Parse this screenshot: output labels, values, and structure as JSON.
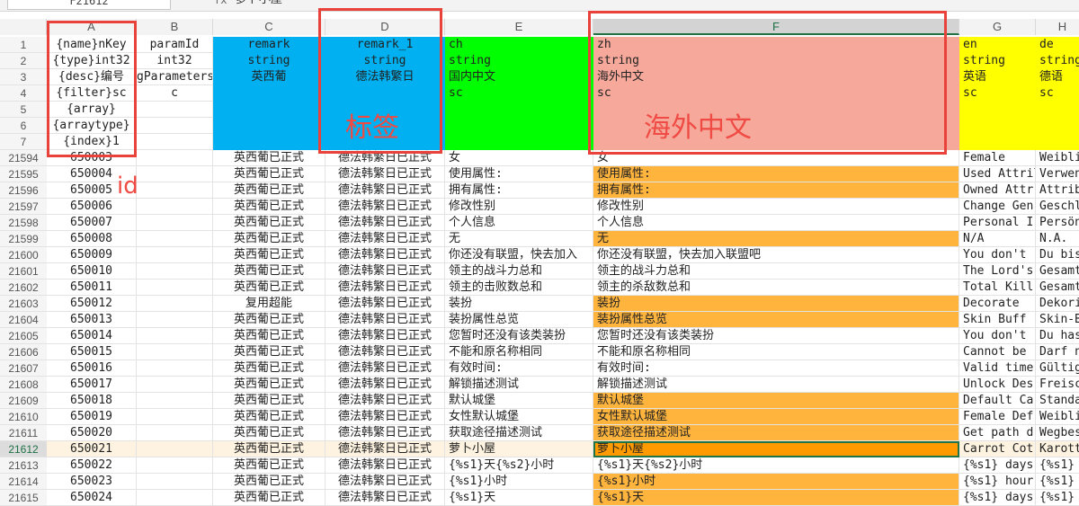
{
  "toolbar": {
    "name_box": "F21612",
    "fx": "fx",
    "formula_value": "萝卜小屋"
  },
  "column_headers": [
    "A",
    "B",
    "C",
    "D",
    "E",
    "F",
    "G",
    "H"
  ],
  "header_rows": {
    "row_numbers": [
      "1",
      "2",
      "3",
      "4",
      "5",
      "6",
      "7"
    ],
    "A": [
      "{name}nKey",
      "{type}int32",
      "{desc}编号",
      "{filter}sc",
      "{array}",
      "{arraytype}",
      "{index}1"
    ],
    "B": [
      "paramId",
      "int32",
      "gParameters",
      "c",
      "",
      "",
      ""
    ],
    "C": [
      "remark",
      "string",
      "英西葡",
      "",
      "",
      "",
      ""
    ],
    "D": [
      "remark_1",
      "string",
      "德法韩繁日",
      "",
      "",
      "",
      ""
    ],
    "E": [
      "ch",
      "string",
      "国内中文",
      "sc",
      "",
      "",
      ""
    ],
    "F": [
      "zh",
      "string",
      "海外中文",
      "sc",
      "",
      "",
      ""
    ],
    "G": [
      "en",
      "string",
      "英语",
      "sc",
      "",
      "",
      ""
    ],
    "H": [
      "de",
      "string",
      "德语",
      "sc",
      "",
      "",
      ""
    ]
  },
  "rows": [
    {
      "n": "21594",
      "a": "650003",
      "b": "",
      "c": "英西葡已正式",
      "d": "德法韩繁日已正式",
      "e": "女",
      "f": "女",
      "g": "Female",
      "h": "Weibli",
      "f_hl": false
    },
    {
      "n": "21595",
      "a": "650004",
      "b": "",
      "c": "英西葡已正式",
      "d": "德法韩繁日已正式",
      "e": "使用属性:",
      "f": "使用属性:",
      "g": "Used Attril",
      "h": "Verwen",
      "f_hl": true
    },
    {
      "n": "21596",
      "a": "650005",
      "b": "",
      "c": "英西葡已正式",
      "d": "德法韩繁日已正式",
      "e": "拥有属性:",
      "f": "拥有属性:",
      "g": "Owned Attr",
      "h": "Attrib",
      "f_hl": true
    },
    {
      "n": "21597",
      "a": "650006",
      "b": "",
      "c": "英西葡已正式",
      "d": "德法韩繁日已正式",
      "e": "修改性别",
      "f": "修改性别",
      "g": "Change Gen",
      "h": "Geschl",
      "f_hl": false
    },
    {
      "n": "21598",
      "a": "650007",
      "b": "",
      "c": "英西葡已正式",
      "d": "德法韩繁日已正式",
      "e": "个人信息",
      "f": "个人信息",
      "g": "Personal I",
      "h": "Persön",
      "f_hl": false
    },
    {
      "n": "21599",
      "a": "650008",
      "b": "",
      "c": "英西葡已正式",
      "d": "德法韩繁日已正式",
      "e": "无",
      "f": "无",
      "g": "N/A",
      "h": "N.A.",
      "f_hl": true
    },
    {
      "n": "21600",
      "a": "650009",
      "b": "",
      "c": "英西葡已正式",
      "d": "德法韩繁日已正式",
      "e": "你还没有联盟，快去加入",
      "f": "你还没有联盟，快去加入联盟吧",
      "g": "You don't",
      "h": "Du bis",
      "f_hl": false
    },
    {
      "n": "21601",
      "a": "650010",
      "b": "",
      "c": "英西葡已正式",
      "d": "德法韩繁日已正式",
      "e": "领主的战斗力总和",
      "f": "领主的战斗力总和",
      "g": "The Lord's",
      "h": "Gesamt",
      "f_hl": false
    },
    {
      "n": "21602",
      "a": "650011",
      "b": "",
      "c": "英西葡已正式",
      "d": "德法韩繁日已正式",
      "e": "领主的击败数总和",
      "f": "领主的杀敌数总和",
      "g": "Total Kill",
      "h": "Gesamt",
      "f_hl": false
    },
    {
      "n": "21603",
      "a": "650012",
      "b": "",
      "c": "复用超能",
      "d": "德法韩繁日已正式",
      "e": "装扮",
      "f": "装扮",
      "g": "Decorate",
      "h": "Dekori",
      "f_hl": true
    },
    {
      "n": "21604",
      "a": "650013",
      "b": "",
      "c": "英西葡已正式",
      "d": "德法韩繁日已正式",
      "e": "装扮属性总览",
      "f": "装扮属性总览",
      "g": "Skin Buff",
      "h": "Skin-B",
      "f_hl": true
    },
    {
      "n": "21605",
      "a": "650014",
      "b": "",
      "c": "英西葡已正式",
      "d": "德法韩繁日已正式",
      "e": "您暂时还没有该类装扮",
      "f": "您暂时还没有该类装扮",
      "g": "You don't",
      "h": "Du has",
      "f_hl": false
    },
    {
      "n": "21606",
      "a": "650015",
      "b": "",
      "c": "英西葡已正式",
      "d": "德法韩繁日已正式",
      "e": "不能和原名称相同",
      "f": "不能和原名称相同",
      "g": "Cannot be",
      "h": "Darf n",
      "f_hl": false
    },
    {
      "n": "21607",
      "a": "650016",
      "b": "",
      "c": "英西葡已正式",
      "d": "德法韩繁日已正式",
      "e": "有效时间:",
      "f": "有效时间:",
      "g": "Valid time",
      "h": "Gültig",
      "f_hl": false
    },
    {
      "n": "21608",
      "a": "650017",
      "b": "",
      "c": "英西葡已正式",
      "d": "德法韩繁日已正式",
      "e": "解锁描述测试",
      "f": "解锁描述测试",
      "g": "Unlock Des",
      "h": "Freisc",
      "f_hl": false
    },
    {
      "n": "21609",
      "a": "650018",
      "b": "",
      "c": "英西葡已正式",
      "d": "德法韩繁日已正式",
      "e": "默认城堡",
      "f": "默认城堡",
      "g": "Default Ca",
      "h": "Standa",
      "f_hl": true
    },
    {
      "n": "21610",
      "a": "650019",
      "b": "",
      "c": "英西葡已正式",
      "d": "德法韩繁日已正式",
      "e": "女性默认城堡",
      "f": "女性默认城堡",
      "g": "Female Def",
      "h": "Weibli",
      "f_hl": true
    },
    {
      "n": "21611",
      "a": "650020",
      "b": "",
      "c": "英西葡已正式",
      "d": "德法韩繁日已正式",
      "e": "获取途径描述测试",
      "f": "获取途径描述测试",
      "g": "Get path d",
      "h": "Wegbes",
      "f_hl": true
    },
    {
      "n": "21612",
      "a": "650021",
      "b": "",
      "c": "英西葡已正式",
      "d": "德法韩繁日已正式",
      "e": "萝卜小屋",
      "f": "萝卜小屋",
      "g": "Carrot Cot",
      "h": "Karott",
      "f_hl": true,
      "selected": true
    },
    {
      "n": "21613",
      "a": "650022",
      "b": "",
      "c": "英西葡已正式",
      "d": "德法韩繁日已正式",
      "e": "{%s1}天{%s2}小时",
      "f": "{%s1}天{%s2}小时",
      "g": "{%s1} days",
      "h": "{%s1}",
      "f_hl": false
    },
    {
      "n": "21614",
      "a": "650023",
      "b": "",
      "c": "英西葡已正式",
      "d": "德法韩繁日已正式",
      "e": "{%s1}小时",
      "f": "{%s1}小时",
      "g": "{%s1} hour",
      "h": "{%s1}",
      "f_hl": true
    },
    {
      "n": "21615",
      "a": "650024",
      "b": "",
      "c": "英西葡已正式",
      "d": "德法韩繁日已正式",
      "e": "{%s1}天",
      "f": "{%s1}天",
      "g": "{%s1} days",
      "h": "{%s1}",
      "f_hl": true
    }
  ],
  "annotations": {
    "id_label": "id",
    "tag_label": "标签",
    "overseas_label": "海外中文"
  },
  "colors": {
    "blue": "#00b0f0",
    "green": "#00ff00",
    "salmon": "#f6a89a",
    "yellow": "#ffff00",
    "orange": "#ffb43d",
    "selected_orange": "#ff9a00",
    "annotation_red": "#e8423b"
  }
}
